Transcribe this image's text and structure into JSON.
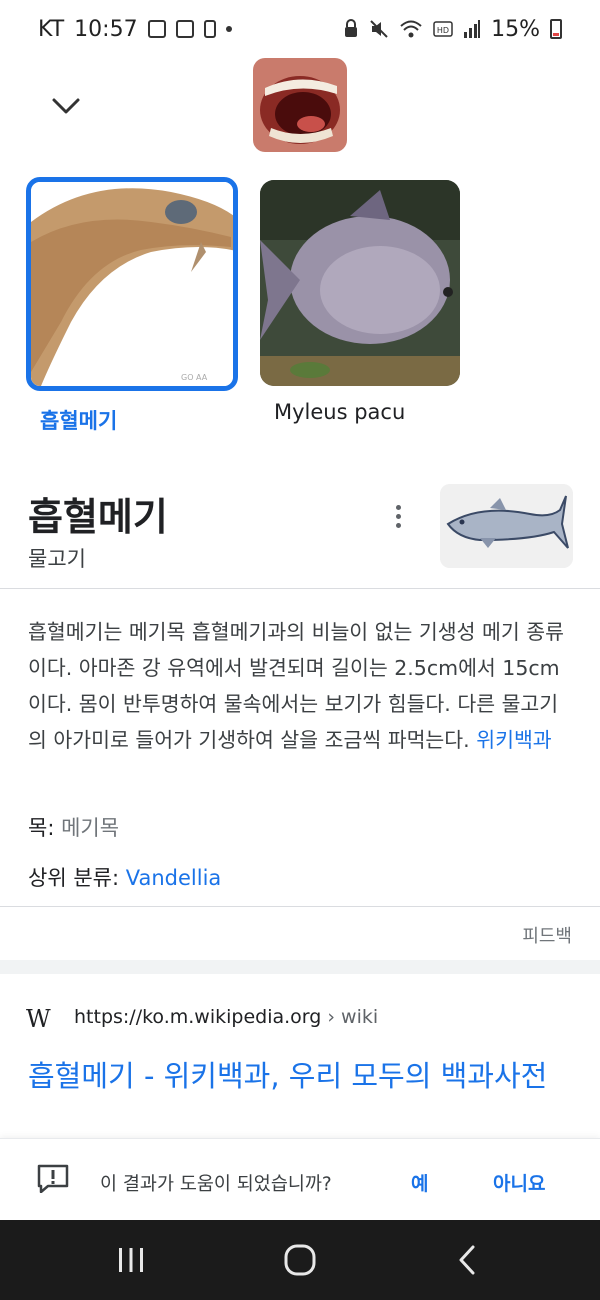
{
  "status_bar": {
    "carrier": "KT",
    "time": "10:57",
    "battery": "15%",
    "left_icons": [
      "gallery-icon",
      "screenshot-icon",
      "alert-icon",
      "dot-icon"
    ],
    "right_icons": [
      "lock-icon",
      "mute-icon",
      "wifi-icon",
      "hd-icon",
      "signal-icon",
      "battery-icon"
    ]
  },
  "header": {
    "collapse_icon": "chevron-down-icon"
  },
  "image_cards": [
    {
      "label": "흡혈메기",
      "selected": true
    },
    {
      "label": "Myleus pacu",
      "selected": false
    }
  ],
  "knowledge_panel": {
    "title": "흡혈메기",
    "subtitle": "물고기",
    "description": "흡혈메기는 메기목 흡혈메기과의 비늘이 없는 기생성 메기 종류이다. 아마존 강 유역에서 발견되며 길이는 2.5cm에서 15cm이다. 몸이 반투명하여 물속에서는 보기가 힘들다. 다른 물고기의 아가미로 들어가 기생하여 살을 조금씩 파먹는다.",
    "source_link": "위키백과",
    "facts": [
      {
        "label": "목",
        "value": "메기목",
        "is_link": false
      },
      {
        "label": "상위 분류",
        "value": "Vandellia",
        "is_link": true
      }
    ],
    "feedback_label": "피드백"
  },
  "search_result": {
    "site_icon": "W",
    "url": "https://ko.m.wikipedia.org",
    "crumb": "› wiki",
    "title": "흡혈메기 - 위키백과, 우리 모두의 백과사전"
  },
  "helpful_bar": {
    "question": "이 결과가 도움이 되었습니까?",
    "yes": "예",
    "no": "아니요"
  },
  "colors": {
    "accent": "#1a73e8",
    "nav_bg": "#1b1b1b",
    "battery_low": "#e04444"
  }
}
